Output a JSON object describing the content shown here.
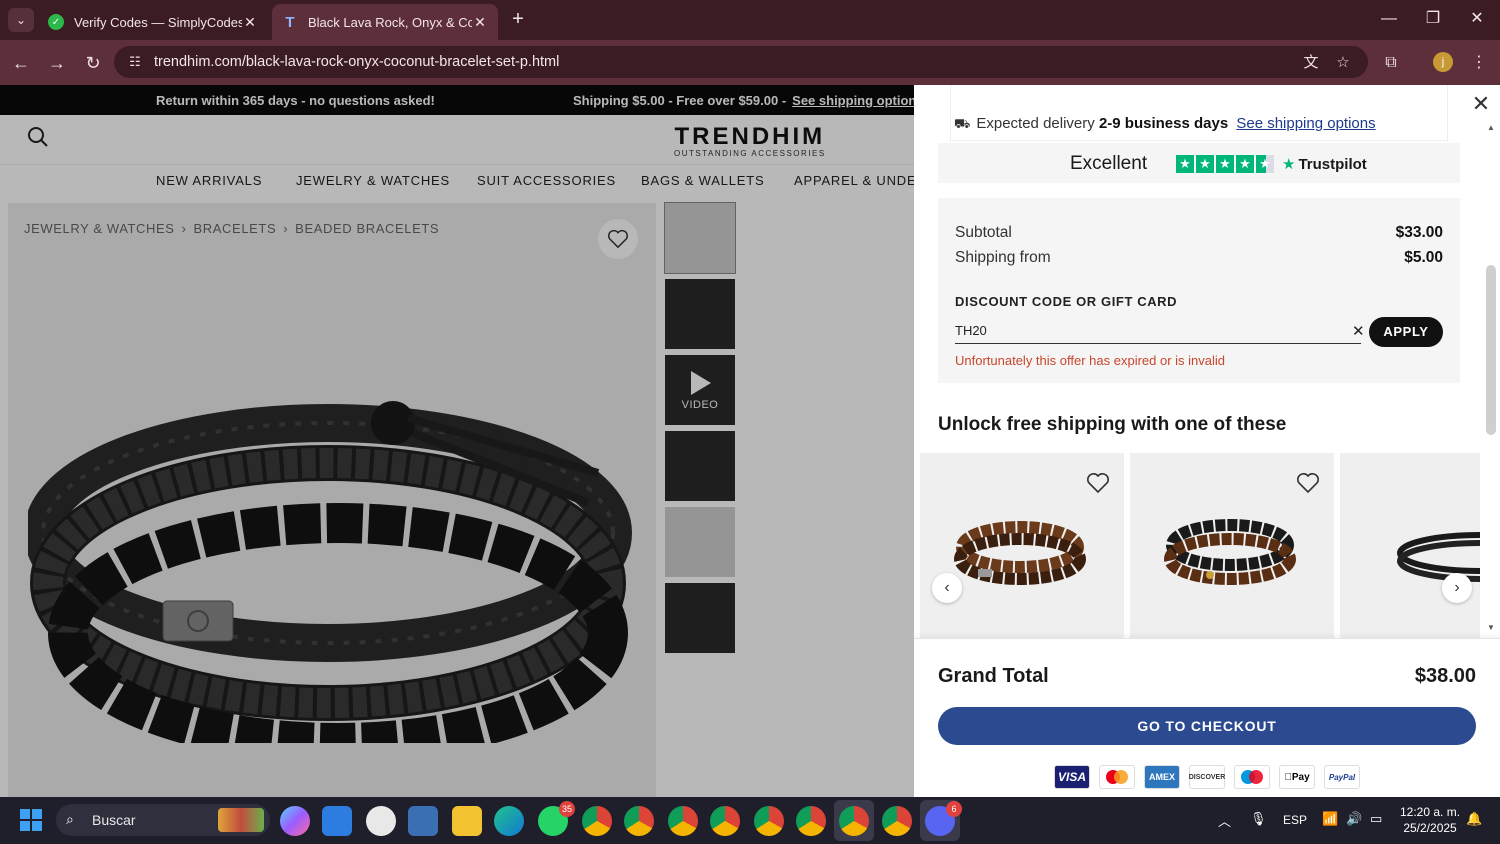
{
  "browser": {
    "tabs": [
      {
        "title": "Verify Codes — SimplyCodes",
        "active": false
      },
      {
        "title": "Black Lava Rock, Onyx & Cocon",
        "active": true
      }
    ],
    "url": "trendhim.com/black-lava-rock-onyx-coconut-bracelet-set-p.html",
    "profile_initial": "j"
  },
  "site": {
    "promo_left": "Return within 365 days - no questions asked!",
    "promo_right": "Shipping $5.00 - Free over $59.00 -",
    "promo_link": "See shipping options",
    "logo": "TRENDHIM",
    "logo_tagline": "OUTSTANDING ACCESSORIES",
    "nav": [
      "NEW ARRIVALS",
      "JEWELRY & WATCHES",
      "SUIT ACCESSORIES",
      "BAGS & WALLETS",
      "APPAREL & UNDER"
    ],
    "breadcrumb": [
      "JEWELRY & WATCHES",
      "BRACELETS",
      "BEADED BRACELETS"
    ],
    "thumb_video_label": "VIDEO"
  },
  "cart": {
    "delivery_prefix": "Expected delivery",
    "delivery_days": "2-9 business days",
    "delivery_link": "See shipping options",
    "trust_word": "Excellent",
    "trust_brand": "Trustpilot",
    "subtotal_label": "Subtotal",
    "subtotal_value": "$33.00",
    "shipping_label": "Shipping from",
    "shipping_value": "$5.00",
    "discount_label": "DISCOUNT CODE OR GIFT CARD",
    "discount_value": "TH20",
    "apply_label": "APPLY",
    "discount_error": "Unfortunately this offer has expired or is invalid",
    "unlock_title": "Unlock free shipping with one of these",
    "grand_total_label": "Grand Total",
    "grand_total_value": "$38.00",
    "checkout_label": "GO TO CHECKOUT",
    "payment_methods": [
      "VISA",
      "Mastercard",
      "AMEX",
      "DISCOVER",
      "Maestro",
      "Pay",
      "PayPal"
    ]
  },
  "taskbar": {
    "search_placeholder": "Buscar",
    "whatsapp_badge": "35",
    "discord_badge": "6",
    "language": "ESP",
    "time": "12:20 a. m.",
    "date": "25/2/2025"
  },
  "colors": {
    "chrome_dark": "#3a1c22",
    "chrome_mid": "#5c2f3a",
    "checkout_blue": "#2b4a8f",
    "error_red": "#c8462d",
    "trustpilot_green": "#00b67a"
  }
}
